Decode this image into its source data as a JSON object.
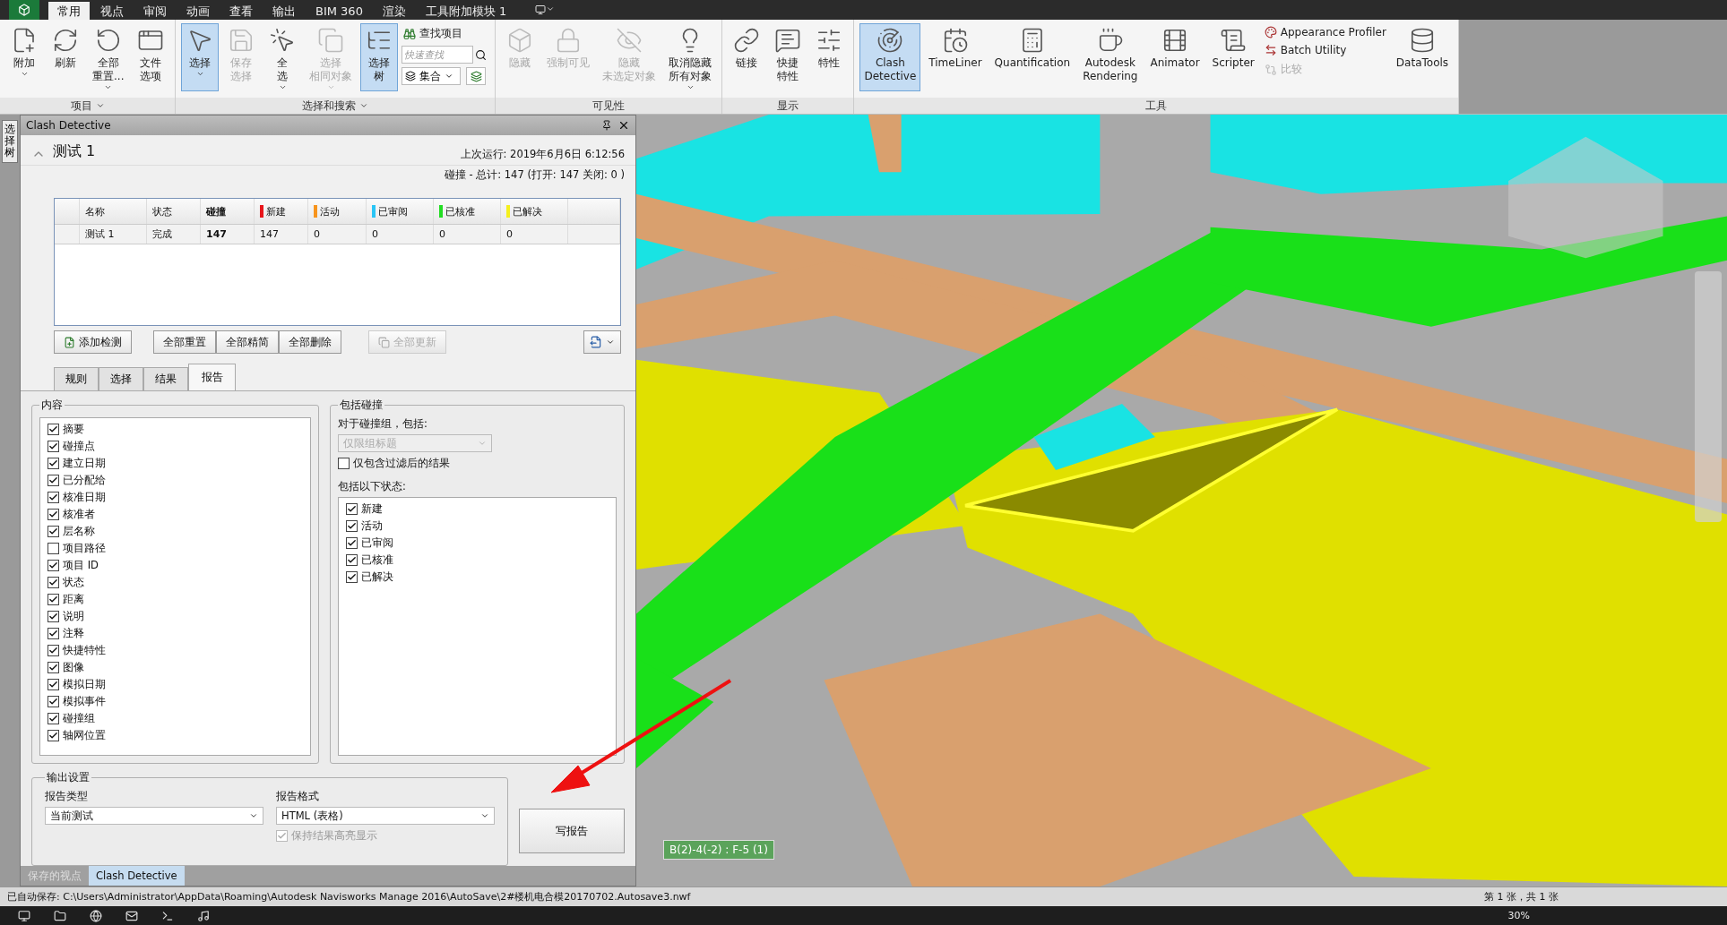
{
  "ribbon_tabs": [
    {
      "label": "常用",
      "selected": true
    },
    {
      "label": "视点",
      "selected": false
    },
    {
      "label": "审阅",
      "selected": false
    },
    {
      "label": "动画",
      "selected": false
    },
    {
      "label": "查看",
      "selected": false
    },
    {
      "label": "输出",
      "selected": false
    },
    {
      "label": "BIM 360",
      "selected": false
    },
    {
      "label": "渲染",
      "selected": false
    },
    {
      "label": "工具附加模块 1",
      "selected": false
    }
  ],
  "ribbon_groups": [
    {
      "title": "项目",
      "expandable": true,
      "items": [
        {
          "kind": "large",
          "lines": [
            "附加"
          ],
          "has_menu": true,
          "disabled": false,
          "selected": false
        },
        {
          "kind": "large",
          "lines": [
            "刷新"
          ],
          "has_menu": false,
          "disabled": false,
          "selected": false
        },
        {
          "kind": "large",
          "lines": [
            "全部",
            "重置..."
          ],
          "has_menu": true,
          "disabled": false,
          "selected": false
        },
        {
          "kind": "large",
          "lines": [
            "文件",
            "选项"
          ],
          "has_menu": false,
          "disabled": false,
          "selected": false
        }
      ]
    },
    {
      "title": "选择和搜索",
      "expandable": true,
      "items": [
        {
          "kind": "large",
          "lines": [
            "选择"
          ],
          "has_menu": true,
          "disabled": false,
          "selected": true
        },
        {
          "kind": "large",
          "lines": [
            "保存",
            "选择"
          ],
          "has_menu": false,
          "disabled": true,
          "selected": false
        },
        {
          "kind": "large",
          "lines": [
            "全",
            "选"
          ],
          "has_menu": true,
          "disabled": false,
          "selected": false
        },
        {
          "kind": "large",
          "lines": [
            "选择",
            "相同对象"
          ],
          "has_menu": true,
          "disabled": true,
          "selected": false
        },
        {
          "kind": "large",
          "lines": [
            "选择",
            "树"
          ],
          "has_menu": false,
          "disabled": false,
          "selected": true
        },
        {
          "kind": "search",
          "find_label": "查找项目",
          "placeholder": "快速查找",
          "set_label": "集合"
        }
      ]
    },
    {
      "title": "可见性",
      "expandable": false,
      "items": [
        {
          "kind": "large",
          "lines": [
            "隐藏"
          ],
          "has_menu": false,
          "disabled": true,
          "selected": false
        },
        {
          "kind": "large",
          "lines": [
            "强制可见"
          ],
          "has_menu": false,
          "disabled": true,
          "selected": false
        },
        {
          "kind": "large",
          "lines": [
            "隐藏",
            "未选定对象"
          ],
          "has_menu": false,
          "disabled": true,
          "selected": false
        },
        {
          "kind": "large",
          "lines": [
            "取消隐藏",
            "所有对象"
          ],
          "has_menu": true,
          "disabled": false,
          "selected": false
        }
      ]
    },
    {
      "title": "显示",
      "expandable": false,
      "items": [
        {
          "kind": "large",
          "lines": [
            "链接"
          ],
          "has_menu": false,
          "disabled": false,
          "selected": false
        },
        {
          "kind": "large",
          "lines": [
            "快捷",
            "特性"
          ],
          "has_menu": false,
          "disabled": false,
          "selected": false
        },
        {
          "kind": "large",
          "lines": [
            "特性"
          ],
          "has_menu": false,
          "disabled": false,
          "selected": false
        }
      ]
    },
    {
      "title": "工具",
      "expandable": false,
      "items": [
        {
          "kind": "large",
          "lines": [
            "Clash",
            "Detective"
          ],
          "has_menu": false,
          "disabled": false,
          "selected": true
        },
        {
          "kind": "large",
          "lines": [
            "TimeLiner"
          ],
          "has_menu": false,
          "disabled": false,
          "selected": false
        },
        {
          "kind": "large",
          "lines": [
            "Quantification"
          ],
          "has_menu": false,
          "disabled": false,
          "selected": false
        },
        {
          "kind": "large",
          "lines": [
            "Autodesk",
            "Rendering"
          ],
          "has_menu": false,
          "disabled": false,
          "selected": false
        },
        {
          "kind": "large",
          "lines": [
            "Animator"
          ],
          "has_menu": false,
          "disabled": false,
          "selected": false
        },
        {
          "kind": "large",
          "lines": [
            "Scripter"
          ],
          "has_menu": false,
          "disabled": false,
          "selected": false
        },
        {
          "kind": "stack",
          "items": [
            {
              "label": "Appearance Profiler",
              "disabled": false
            },
            {
              "label": "Batch Utility",
              "disabled": false
            },
            {
              "label": "比较",
              "disabled": true
            }
          ]
        },
        {
          "kind": "large",
          "lines": [
            "DataTools"
          ],
          "has_menu": false,
          "disabled": false,
          "selected": false
        }
      ]
    }
  ],
  "side_tab": "选择树",
  "panel": {
    "title": "Clash Detective",
    "test_name": "测试 1",
    "expanded": true,
    "last_run": "上次运行:  2019年6月6日 6:12:56",
    "summary": "碰撞 -  总计:  147  (打开:  147  关闭:  0 )",
    "columns": [
      {
        "label": "名称"
      },
      {
        "label": "状态"
      },
      {
        "label": "碰撞"
      },
      {
        "label": "新建",
        "color": "#e8161b"
      },
      {
        "label": "活动",
        "color": "#f7941d"
      },
      {
        "label": "已审阅",
        "color": "#29c5f6"
      },
      {
        "label": "已核准",
        "color": "#22dd22"
      },
      {
        "label": "已解决",
        "color": "#f5f01e"
      }
    ],
    "rows": [
      {
        "cells": [
          "测试 1",
          "完成",
          "147",
          "147",
          "0",
          "0",
          "0",
          "0"
        ]
      }
    ],
    "buttons": [
      {
        "label": "添加检测",
        "disabled": false
      },
      {
        "label": "全部重置",
        "disabled": false
      },
      {
        "label": "全部精简",
        "disabled": false
      },
      {
        "label": "全部删除",
        "disabled": false
      },
      {
        "label": "全部更新",
        "disabled": true
      }
    ],
    "tabs": [
      {
        "label": "规则",
        "selected": false
      },
      {
        "label": "选择",
        "selected": false
      },
      {
        "label": "结果",
        "selected": false
      },
      {
        "label": "报告",
        "selected": true
      }
    ],
    "contents": {
      "title": "内容",
      "items": [
        {
          "label": "摘要",
          "checked": true
        },
        {
          "label": "碰撞点",
          "checked": true
        },
        {
          "label": "建立日期",
          "checked": true
        },
        {
          "label": "已分配给",
          "checked": true
        },
        {
          "label": "核准日期",
          "checked": true
        },
        {
          "label": "核准者",
          "checked": true
        },
        {
          "label": "层名称",
          "checked": true
        },
        {
          "label": "项目路径",
          "checked": false
        },
        {
          "label": "项目 ID",
          "checked": true
        },
        {
          "label": "状态",
          "checked": true
        },
        {
          "label": "距离",
          "checked": true
        },
        {
          "label": "说明",
          "checked": true
        },
        {
          "label": "注释",
          "checked": true
        },
        {
          "label": "快捷特性",
          "checked": true
        },
        {
          "label": "图像",
          "checked": true
        },
        {
          "label": "模拟日期",
          "checked": true
        },
        {
          "label": "模拟事件",
          "checked": true
        },
        {
          "label": "碰撞组",
          "checked": true
        },
        {
          "label": "轴网位置",
          "checked": true
        }
      ]
    },
    "include": {
      "title": "包括碰撞",
      "group_label": "对于碰撞组，包括:",
      "group_select": "仅限组标题",
      "group_select_disabled": true,
      "filtered_label": "仅包含过滤后的结果",
      "filtered_checked": false,
      "status_label": "包括以下状态:",
      "statuses": [
        {
          "label": "新建",
          "checked": true
        },
        {
          "label": "活动",
          "checked": true
        },
        {
          "label": "已审阅",
          "checked": true
        },
        {
          "label": "已核准",
          "checked": true
        },
        {
          "label": "已解决",
          "checked": true
        }
      ]
    },
    "output": {
      "title": "输出设置",
      "type_label": "报告类型",
      "type_value": "当前测试",
      "format_label": "报告格式",
      "format_value": "HTML (表格)",
      "keep_label": "保持结果高亮显示",
      "keep_checked": true,
      "keep_disabled": true
    },
    "write_button": "写报告"
  },
  "bottom_tabs": [
    {
      "label": "保存的视点",
      "selected": false
    },
    {
      "label": "Clash Detective",
      "selected": true
    }
  ],
  "viewport": {
    "label": "B(2)-4(-2) : F-5 (1)"
  },
  "status_bar": {
    "text": "已自动保存: C:\\Users\\Administrator\\AppData\\Roaming\\Autodesk Navisworks Manage 2016\\AutoSave\\2#楼机电合模20170702.Autosave3.nwf",
    "page": "第 1 张，共 1 张"
  },
  "taskbar": {
    "zoom": "30%"
  }
}
